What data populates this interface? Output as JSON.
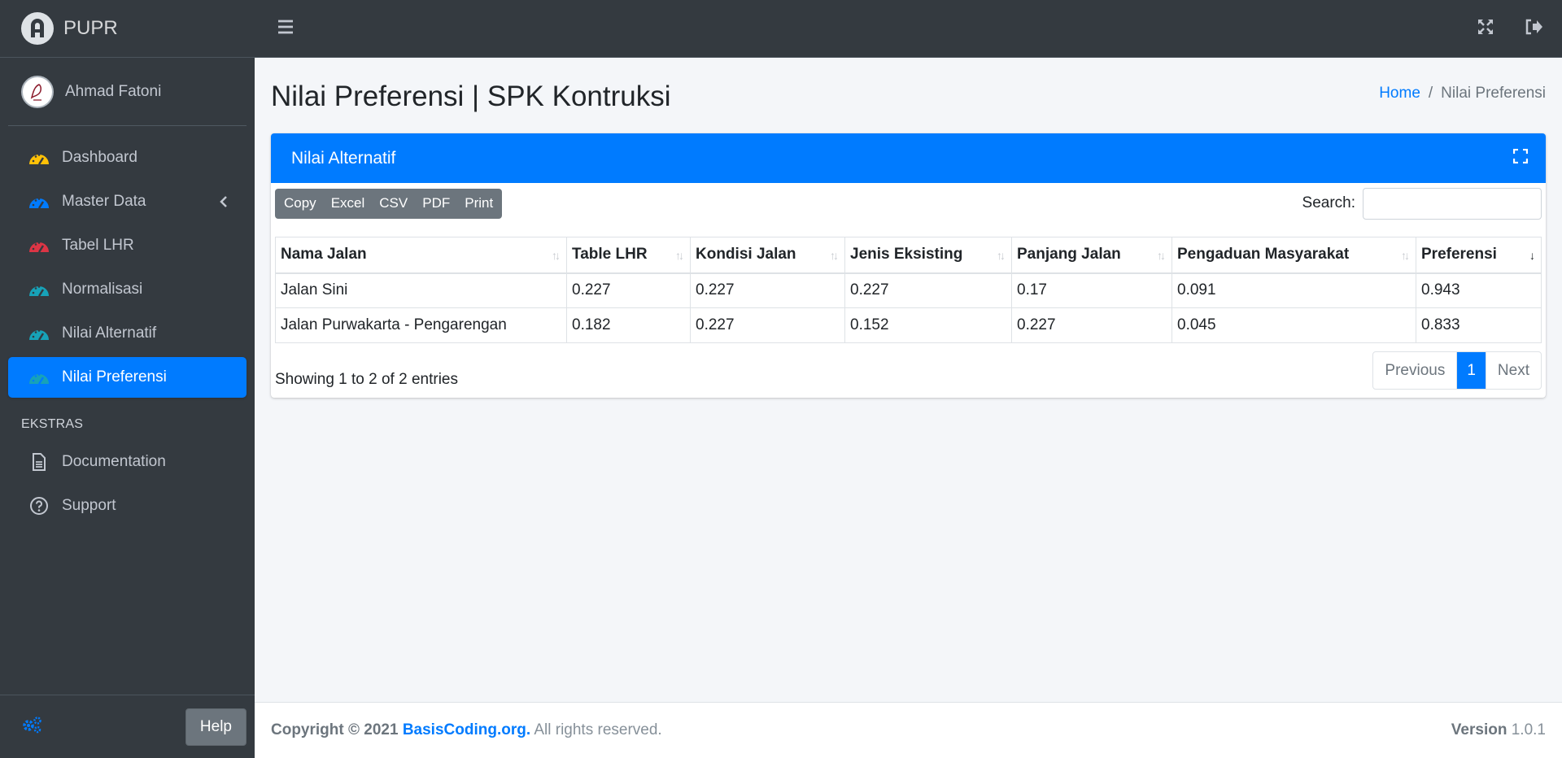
{
  "brand": {
    "name": "PUPR"
  },
  "user": {
    "name": "Ahmad Fatoni"
  },
  "sidebar": {
    "items": [
      {
        "label": "Dashboard",
        "icon": "dashboard-gauge-icon",
        "color": "#ffc107"
      },
      {
        "label": "Master Data",
        "icon": "master-data-gauge-icon",
        "color": "#007bff"
      },
      {
        "label": "Tabel LHR",
        "icon": "tabel-lhr-gauge-icon",
        "color": "#dc3545"
      },
      {
        "label": "Normalisasi",
        "icon": "normalisasi-gauge-icon",
        "color": "#17a2b8"
      },
      {
        "label": "Nilai Alternatif",
        "icon": "nilai-alternatif-gauge-icon",
        "color": "#17a2b8"
      },
      {
        "label": "Nilai Preferensi",
        "icon": "nilai-preferensi-gauge-icon",
        "color": "#17a2b8",
        "active": true
      }
    ],
    "section_header": "EKSTRAS",
    "extras": [
      {
        "label": "Documentation",
        "icon": "file-icon"
      },
      {
        "label": "Support",
        "icon": "question-circle-icon"
      }
    ],
    "help_label": "Help"
  },
  "header": {
    "title": "Nilai Preferensi | SPK Kontruksi",
    "breadcrumb": {
      "home": "Home",
      "separator": "/",
      "current": "Nilai Preferensi"
    }
  },
  "card": {
    "title": "Nilai Alternatif",
    "buttons": [
      "Copy",
      "Excel",
      "CSV",
      "PDF",
      "Print"
    ],
    "search_label": "Search:",
    "search_value": "",
    "table": {
      "columns": [
        "Nama Jalan",
        "Table LHR",
        "Kondisi Jalan",
        "Jenis Eksisting",
        "Panjang Jalan",
        "Pengaduan Masyarakat",
        "Preferensi"
      ],
      "rows": [
        [
          "Jalan Sini",
          "0.227",
          "0.227",
          "0.227",
          "0.17",
          "0.091",
          "0.943"
        ],
        [
          "Jalan Purwakarta - Pengarengan",
          "0.182",
          "0.227",
          "0.152",
          "0.227",
          "0.045",
          "0.833"
        ]
      ]
    },
    "info": "Showing 1 to 2 of 2 entries",
    "pagination": {
      "previous": "Previous",
      "current": "1",
      "next": "Next"
    }
  },
  "footer": {
    "copyright": "Copyright © 2021",
    "site": "BasisCoding.org.",
    "rights": "All rights reserved.",
    "version_label": "Version",
    "version": "1.0.1"
  },
  "colors": {
    "accent": "#007bff",
    "sidebar": "#343a40"
  }
}
